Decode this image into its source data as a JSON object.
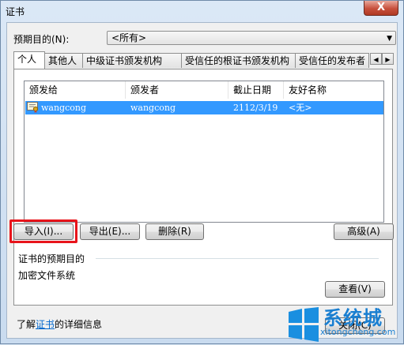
{
  "window": {
    "title": "证书",
    "close_glyph": "X"
  },
  "purpose": {
    "label": "预期目的(N):",
    "selected": "<所有>"
  },
  "tabs": [
    "个人",
    "其他人",
    "中级证书颁发机构",
    "受信任的根证书颁发机构",
    "受信任的发布者"
  ],
  "list": {
    "columns": [
      "颁发给",
      "颁发者",
      "截止日期",
      "友好名称"
    ],
    "rows": [
      {
        "issued_to": "wangcong",
        "issued_by": "wangcong",
        "expiry": "2112/3/19",
        "friendly_name": "<无>"
      }
    ]
  },
  "buttons": {
    "import": "导入(I)...",
    "export": "导出(E)...",
    "remove": "删除(R)",
    "advanced": "高级(A)",
    "view": "查看(V)",
    "close": "关闭(C)"
  },
  "purposes_group": {
    "title": "证书的预期目的",
    "value": "加密文件系统"
  },
  "learn_more": {
    "prefix": "了解",
    "link": "证书",
    "suffix": "的详细信息"
  },
  "watermark": {
    "text": "系统城",
    "url": "xitongcheng.com"
  },
  "colors": {
    "selection": "#3399ff",
    "highlight_box": "#e8141b",
    "link": "#0066cc",
    "close_button": "#c7503c"
  }
}
